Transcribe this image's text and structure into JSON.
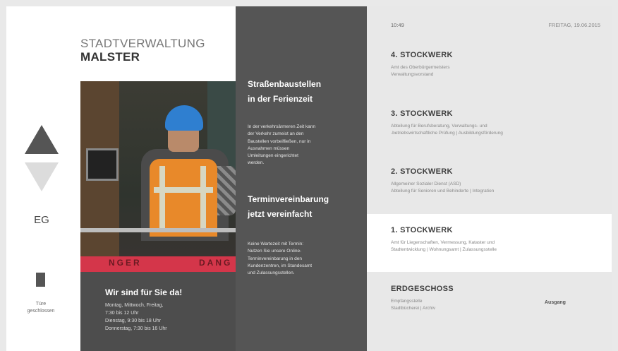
{
  "nav": {
    "current_floor": "EG",
    "door_status": [
      "Türe",
      "geschlossen"
    ]
  },
  "header": {
    "title": "STADTVERWALTUNG",
    "subtitle": "MALSTER"
  },
  "photo": {
    "sign_text_left": "NGER",
    "sign_text_right": "DANG"
  },
  "hours": {
    "title": "Wir sind für Sie da!",
    "lines": [
      "Montag, Mittwoch, Freitag,",
      "7:30 bis 12 Uhr",
      "Dienstag, 9:30 bis 18 Uhr",
      "Donnerstag, 7:30 bis 16 Uhr"
    ]
  },
  "news": [
    {
      "title_lines": [
        "Straßenbaustellen",
        "in der Ferienzeit"
      ],
      "text_lines": [
        "In der verkehrsärmeren Zeit kann",
        "der Verkehr zumeist an den",
        "Baustellen vorbeifließen, nur in",
        "Ausnahmen müssen",
        "Umleitungen eingerichtet",
        "werden."
      ]
    },
    {
      "title_lines": [
        "Terminvereinbarung",
        "jetzt vereinfacht"
      ],
      "text_lines": [
        "Keine Wartezeit mit Termin:",
        "Nutzen Sie unsere Online-",
        "Terminvereinbarung in den",
        "Kundenzentren, im Standesamt",
        "und Zulassungsstellen."
      ]
    }
  ],
  "directory": {
    "time": "10:49",
    "date": "FREITAG, 19.06.2015",
    "exit_label": "Ausgang",
    "floors": [
      {
        "title": "4. STOCKWERK",
        "lines": [
          "Amt des Oberbürgermeisters",
          "Verwaltungsvorstand"
        ],
        "active": false
      },
      {
        "title": "3. STOCKWERK",
        "lines": [
          "Abteilung für Berufsberatung, Verwaltungs- und",
          "-betriebswirtschaftliche Prüfung | Ausbildungsförderung"
        ],
        "active": false
      },
      {
        "title": "2. STOCKWERK",
        "lines": [
          "Allgemeiner Sozialer Dienst (ASD)",
          "Abteilung für Senioren und Behinderte | Integration"
        ],
        "active": false
      },
      {
        "title": "1. STOCKWERK",
        "lines": [
          "Amt für Liegenschaften, Vermessung, Kataster und",
          "Stadtentwicklung | Wohnungsamt | Zulassungsstelle"
        ],
        "active": true
      },
      {
        "title": "ERDGESCHOSS",
        "lines": [
          "Empfangsstelle",
          "Stadtbücherei | Archiv"
        ],
        "active": false
      }
    ]
  }
}
